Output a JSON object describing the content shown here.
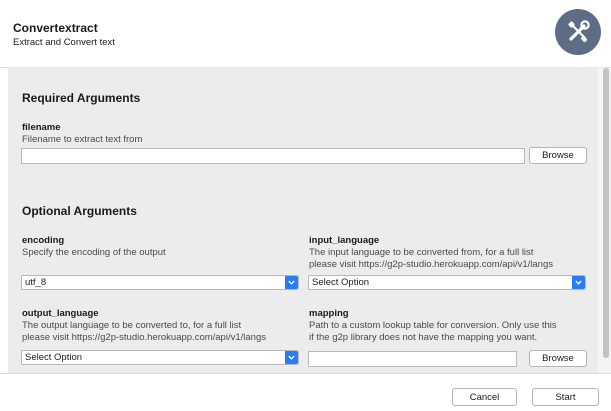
{
  "app": {
    "title": "Convertextract",
    "subtitle": "Extract and Convert text"
  },
  "required": {
    "section_title": "Required Arguments",
    "filename": {
      "label": "filename",
      "help": "Filename to extract text from",
      "value": "",
      "browse_label": "Browse"
    }
  },
  "optional": {
    "section_title": "Optional Arguments",
    "encoding": {
      "label": "encoding",
      "help": "Specify the encoding of the output",
      "selected": "utf_8"
    },
    "input_language": {
      "label": "input_language",
      "help_line1": "The input language to be converted from, for a full list",
      "help_line2": "please visit https://g2p-studio.herokuapp.com/api/v1/langs",
      "selected": "Select Option"
    },
    "output_language": {
      "label": "output_language",
      "help_line1": "The output language to be converted to, for a full list",
      "help_line2": "please visit https://g2p-studio.herokuapp.com/api/v1/langs",
      "selected": "Select Option"
    },
    "mapping": {
      "label": "mapping",
      "help_line1": "Path to a custom lookup table for conversion. Only use this",
      "help_line2": "if the g2p library does not have the mapping you want.",
      "value": "",
      "browse_label": "Browse"
    }
  },
  "footer": {
    "cancel_label": "Cancel",
    "start_label": "Start"
  },
  "colors": {
    "accent": "#2a7bf6",
    "logo_bg": "#5e6d86"
  },
  "icons": {
    "logo": "tools-icon",
    "dropdown": "chevron-down-icon"
  }
}
